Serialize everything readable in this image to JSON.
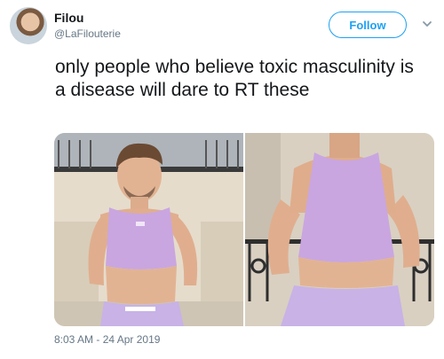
{
  "author": {
    "display_name": "Filou",
    "handle": "@LaFilouterie"
  },
  "follow_label": "Follow",
  "tweet_text": "only people who believe toxic masculinity is a disease will dare to RT these",
  "timestamp": "8:03 AM - 24 Apr 2019",
  "colors": {
    "accent": "#1da1f2",
    "text": "#14171a",
    "secondary_text": "#657786",
    "top_lavender": "#c9a6e0",
    "shorts_lavender": "#c8b2e6"
  },
  "icons": [
    "avatar",
    "caret-down-icon"
  ]
}
